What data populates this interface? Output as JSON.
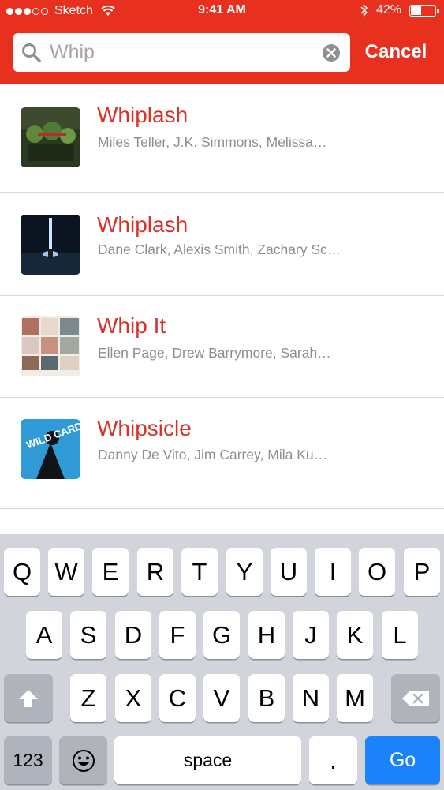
{
  "status_bar": {
    "carrier": "Sketch",
    "time": "9:41 AM",
    "battery": "42%",
    "battery_level": 0.42
  },
  "search": {
    "value": "",
    "placeholder": "Whip",
    "cancel_label": "Cancel"
  },
  "results": [
    {
      "title": "Whiplash",
      "cast": "Miles Teller, J.K. Simmons, Melissa…"
    },
    {
      "title": "Whiplash",
      "cast": "Dane Clark, Alexis Smith, Zachary Sc…"
    },
    {
      "title": "Whip It",
      "cast": "Ellen Page, Drew Barrymore, Sarah…"
    },
    {
      "title": "Whipsicle",
      "cast": "Danny De Vito, Jim Carrey, Mila Ku…"
    }
  ],
  "posters": {
    "wild_card_text": "WILD CARD"
  },
  "keyboard": {
    "row1": [
      "Q",
      "W",
      "E",
      "R",
      "T",
      "Y",
      "U",
      "I",
      "O",
      "P"
    ],
    "row2": [
      "A",
      "S",
      "D",
      "F",
      "G",
      "H",
      "J",
      "K",
      "L"
    ],
    "row3": [
      "Z",
      "X",
      "C",
      "V",
      "B",
      "N",
      "M"
    ],
    "numbers_label": "123",
    "space_label": "space",
    "period_label": ".",
    "go_label": "Go"
  },
  "colors": {
    "accent": "#e8301f",
    "title_red": "#d8332a",
    "go_blue": "#1a82fb"
  }
}
